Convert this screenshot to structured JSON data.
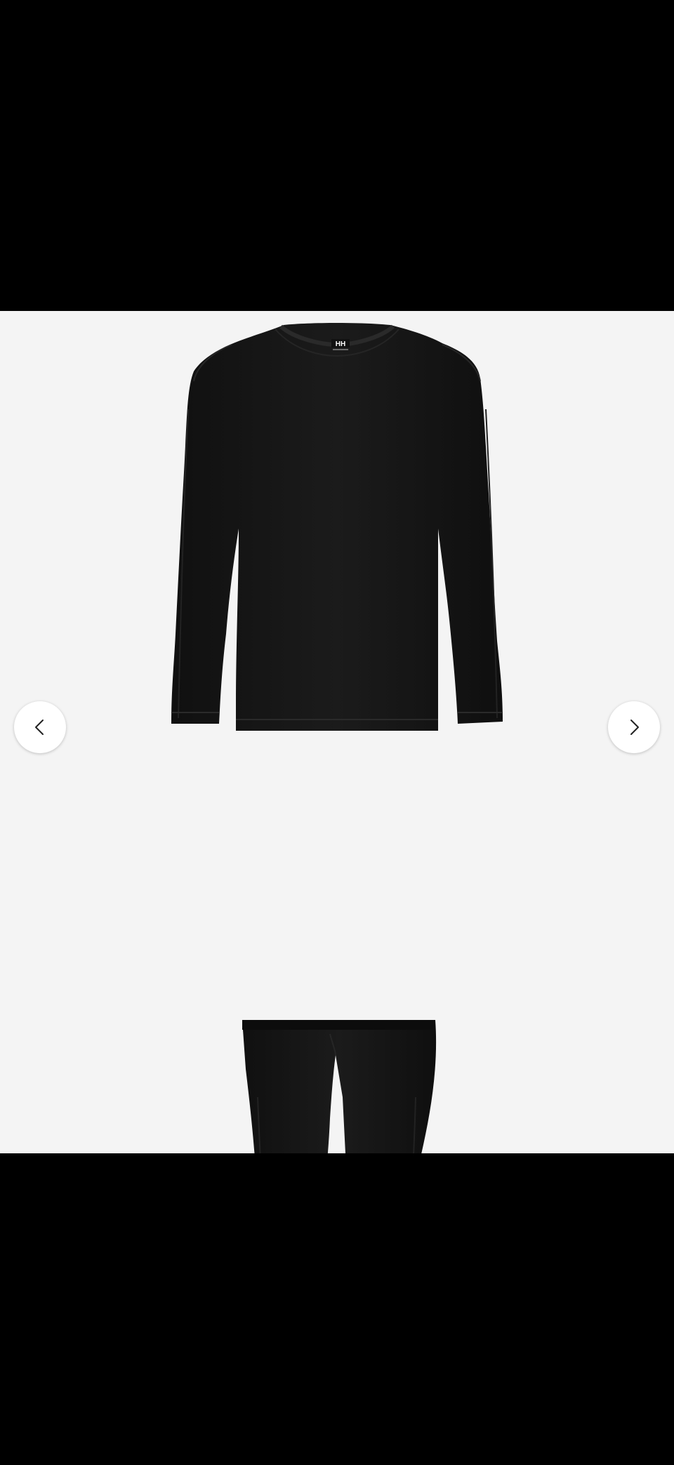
{
  "viewer": {
    "background": "#f4f4f4",
    "product": {
      "brand_logo_text": "HH",
      "garment_color": "#171717",
      "items": [
        "long-sleeve top",
        "leggings"
      ]
    },
    "controls": {
      "prev_icon": "chevron-left-icon",
      "next_icon": "chevron-right-icon"
    }
  },
  "letterbox_color": "#000000"
}
